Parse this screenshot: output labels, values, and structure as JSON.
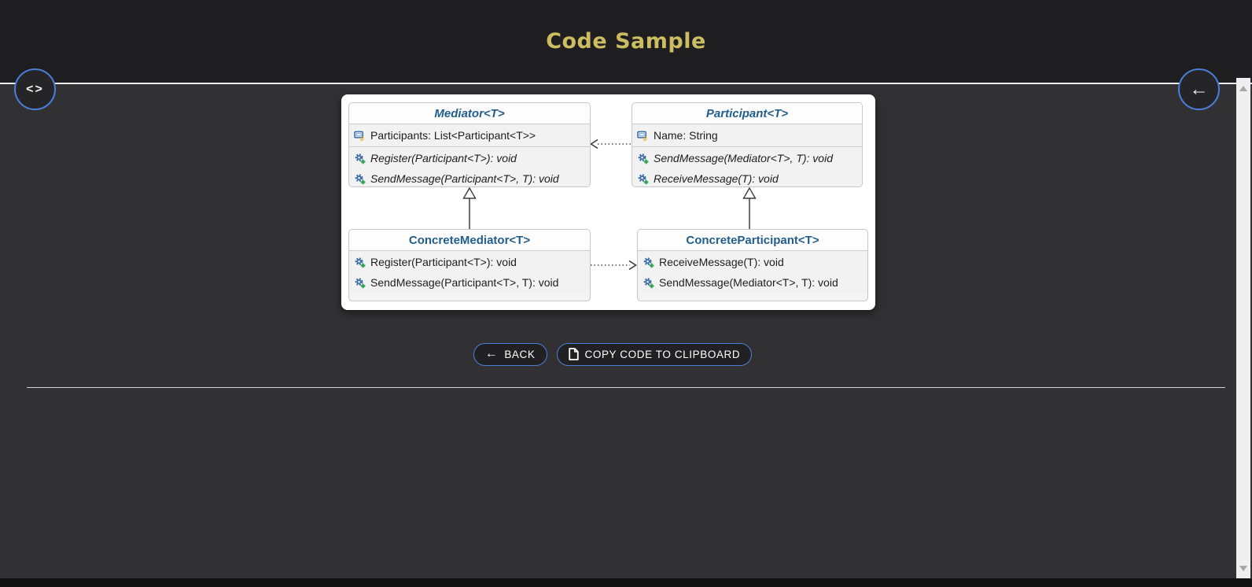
{
  "header": {
    "title": "Code Sample"
  },
  "nav": {
    "left_button": {
      "icon": "code-icon",
      "glyph": "<>"
    },
    "right_button": {
      "icon": "back-arrow-icon",
      "glyph": "←"
    }
  },
  "colors": {
    "accent_blue": "#4c7ed9",
    "title_gold": "#cdbd62",
    "class_name_blue": "#215e8c",
    "header_bg": "#1e1e20",
    "content_bg": "#313134",
    "panel_bg": "#ffffff"
  },
  "diagram": {
    "classes": [
      {
        "name": "Mediator<T>",
        "abstract": true,
        "attributes": [
          {
            "icon": "field-icon",
            "text": "Participants: List<Participant<T>>"
          }
        ],
        "methods": [
          {
            "icon": "method-gear-icon",
            "text": "Register(Participant<T>): void"
          },
          {
            "icon": "method-gear-icon",
            "text": "SendMessage(Participant<T>, T): void"
          }
        ]
      },
      {
        "name": "Participant<T>",
        "abstract": true,
        "attributes": [
          {
            "icon": "field-icon",
            "text": "Name: String"
          }
        ],
        "methods": [
          {
            "icon": "method-gear-icon",
            "text": "SendMessage(Mediator<T>, T): void"
          },
          {
            "icon": "method-gear-icon",
            "text": "ReceiveMessage(T): void"
          }
        ]
      },
      {
        "name": "ConcreteMediator<T>",
        "abstract": false,
        "attributes": [],
        "methods": [
          {
            "icon": "method-gear-icon",
            "text": "Register(Participant<T>): void"
          },
          {
            "icon": "method-gear-icon",
            "text": "SendMessage(Participant<T>, T): void"
          }
        ]
      },
      {
        "name": "ConcreteParticipant<T>",
        "abstract": false,
        "attributes": [],
        "methods": [
          {
            "icon": "method-gear-icon",
            "text": "ReceiveMessage(T): void"
          },
          {
            "icon": "method-gear-icon",
            "text": "SendMessage(Mediator<T>, T): void"
          }
        ]
      }
    ],
    "relations": [
      {
        "type": "dashed-dependency",
        "from": "Participant<T>",
        "to": "Mediator<T>"
      },
      {
        "type": "inheritance",
        "from": "ConcreteMediator<T>",
        "to": "Mediator<T>"
      },
      {
        "type": "inheritance",
        "from": "ConcreteParticipant<T>",
        "to": "Participant<T>"
      },
      {
        "type": "dashed-dependency",
        "from": "ConcreteMediator<T>",
        "to": "ConcreteParticipant<T>"
      }
    ]
  },
  "actions": {
    "back_label": "BACK",
    "back_icon": "left-arrow-icon",
    "copy_label": "COPY CODE TO CLIPBOARD",
    "copy_icon": "document-icon"
  }
}
